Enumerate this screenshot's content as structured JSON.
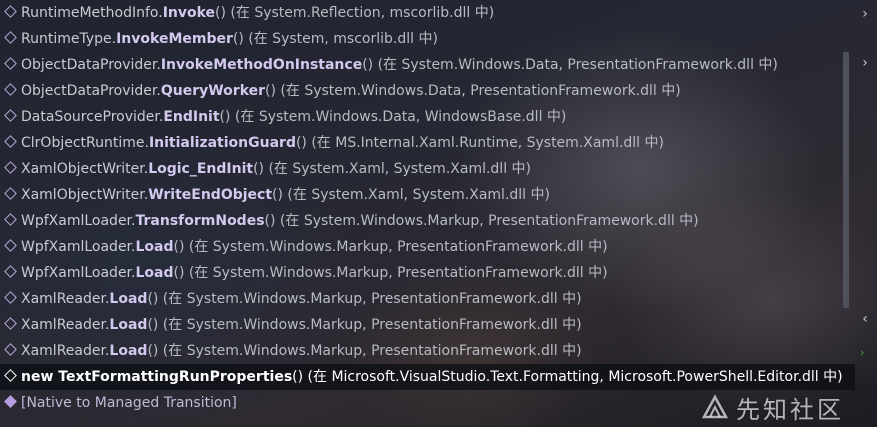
{
  "call_stack": {
    "frames": [
      {
        "cls": "RuntimeMethodInfo.",
        "method": "Invoke",
        "loc": "() (在 System.Reflection, mscorlib.dll 中)"
      },
      {
        "cls": "RuntimeType.",
        "method": "InvokeMember",
        "loc": "() (在 System, mscorlib.dll 中)"
      },
      {
        "cls": "ObjectDataProvider.",
        "method": "InvokeMethodOnInstance",
        "loc": "() (在 System.Windows.Data, PresentationFramework.dll 中)"
      },
      {
        "cls": "ObjectDataProvider.",
        "method": "QueryWorker",
        "loc": "() (在 System.Windows.Data, PresentationFramework.dll 中)"
      },
      {
        "cls": "DataSourceProvider.",
        "method": "EndInit",
        "loc": "() (在 System.Windows.Data, WindowsBase.dll 中)"
      },
      {
        "cls": "ClrObjectRuntime.",
        "method": "InitializationGuard",
        "loc": "() (在 MS.Internal.Xaml.Runtime, System.Xaml.dll 中)"
      },
      {
        "cls": "XamlObjectWriter.",
        "method": "Logic_EndInit",
        "loc": "() (在 System.Xaml, System.Xaml.dll 中)"
      },
      {
        "cls": "XamlObjectWriter.",
        "method": "WriteEndObject",
        "loc": "() (在 System.Xaml, System.Xaml.dll 中)"
      },
      {
        "cls": "WpfXamlLoader.",
        "method": "TransformNodes",
        "loc": "() (在 System.Windows.Markup, PresentationFramework.dll 中)"
      },
      {
        "cls": "WpfXamlLoader.",
        "method": "Load",
        "loc": "() (在 System.Windows.Markup, PresentationFramework.dll 中)"
      },
      {
        "cls": "WpfXamlLoader.",
        "method": "Load",
        "loc": "() (在 System.Windows.Markup, PresentationFramework.dll 中)"
      },
      {
        "cls": "XamlReader.",
        "method": "Load",
        "loc": "() (在 System.Windows.Markup, PresentationFramework.dll 中)"
      },
      {
        "cls": "XamlReader.",
        "method": "Load",
        "loc": "() (在 System.Windows.Markup, PresentationFramework.dll 中)"
      },
      {
        "cls": "XamlReader.",
        "method": "Load",
        "loc": "() (在 System.Windows.Markup, PresentationFramework.dll 中)"
      },
      {
        "cls": "new ",
        "method": "TextFormattingRunProperties",
        "loc": "() (在 Microsoft.VisualStudio.Text.Formatting, Microsoft.PowerShell.Editor.dll 中)"
      }
    ],
    "native_frame": "[Native to Managed Transition]"
  },
  "watermark": {
    "text": "先知社区"
  },
  "colors": {
    "accent": "#d3c8ee",
    "native_marker": "#b39ce0",
    "current_row": "#0a0c12"
  }
}
